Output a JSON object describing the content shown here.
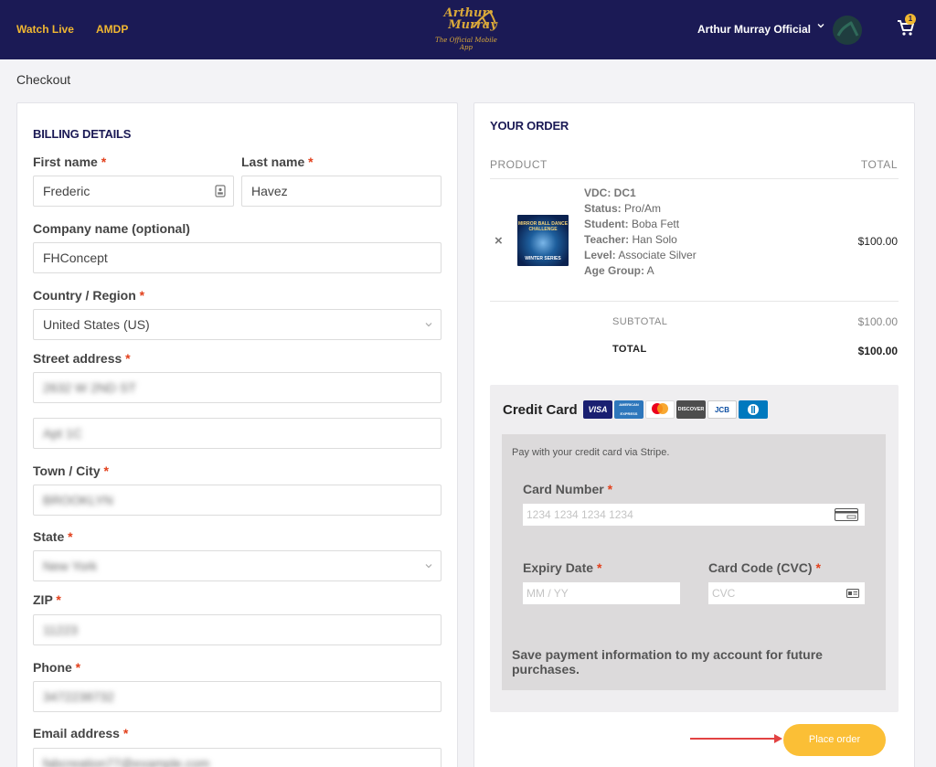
{
  "header": {
    "nav": [
      "Watch Live",
      "AMDP"
    ],
    "logo": {
      "line1": "Arthur",
      "line2": "Murray",
      "tagline": "The Official Mobile App"
    },
    "user_name": "Arthur Murray Official",
    "cart_count": "1"
  },
  "breadcrumb": "Checkout",
  "billing": {
    "title": "BILLING DETAILS",
    "first_name_label": "First name",
    "first_name_value": "Frederic",
    "last_name_label": "Last name",
    "last_name_value": "Havez",
    "company_label": "Company name (optional)",
    "company_value": "FHConcept",
    "country_label": "Country / Region",
    "country_value": "United States (US)",
    "street_label": "Street address",
    "street_value_1": "2632 W 2ND ST",
    "street_value_2": "Apt 1C",
    "city_label": "Town / City",
    "city_value": "BROOKLYN",
    "state_label": "State",
    "state_value": "New York",
    "zip_label": "ZIP",
    "zip_value": "11223",
    "phone_label": "Phone",
    "phone_value": "3472238732",
    "email_label": "Email address",
    "email_value": "fabcreation77@example.com",
    "required_mark": "*"
  },
  "order": {
    "title": "YOUR ORDER",
    "col_product": "PRODUCT",
    "col_total": "TOTAL",
    "remove_symbol": "×",
    "thumb_title": "MIRROR BALL DANCE CHALLENGE",
    "thumb_sub": "WINTER SERIES",
    "item_name": "VDC: DC1",
    "item_meta": [
      {
        "key": "Status:",
        "value": "Pro/Am"
      },
      {
        "key": "Student:",
        "value": "Boba Fett"
      },
      {
        "key": "Teacher:",
        "value": "Han Solo"
      },
      {
        "key": "Level:",
        "value": "Associate Silver"
      },
      {
        "key": "Age Group:",
        "value": "A"
      }
    ],
    "item_total": "$100.00",
    "subtotal_label": "SUBTOTAL",
    "subtotal_value": "$100.00",
    "total_label": "TOTAL",
    "total_value": "$100.00"
  },
  "payment": {
    "method_title": "Credit Card",
    "card_brands": [
      "VISA",
      "AMERICAN EXPRESS",
      "mastercard",
      "DISCOVER",
      "JCB",
      "Diners Club"
    ],
    "note": "Pay with your credit card via Stripe.",
    "card_number_label": "Card Number",
    "card_number_placeholder": "1234 1234 1234 1234",
    "expiry_label": "Expiry Date",
    "expiry_placeholder": "MM / YY",
    "cvc_label": "Card Code (CVC)",
    "cvc_placeholder": "CVC",
    "save_label": "Save payment information to my account for future purchases."
  },
  "place_order_label": "Place order",
  "colors": {
    "navy": "#1b1a55",
    "gold": "#f0b731",
    "button": "#fbbf36",
    "required": "#e2401c"
  }
}
